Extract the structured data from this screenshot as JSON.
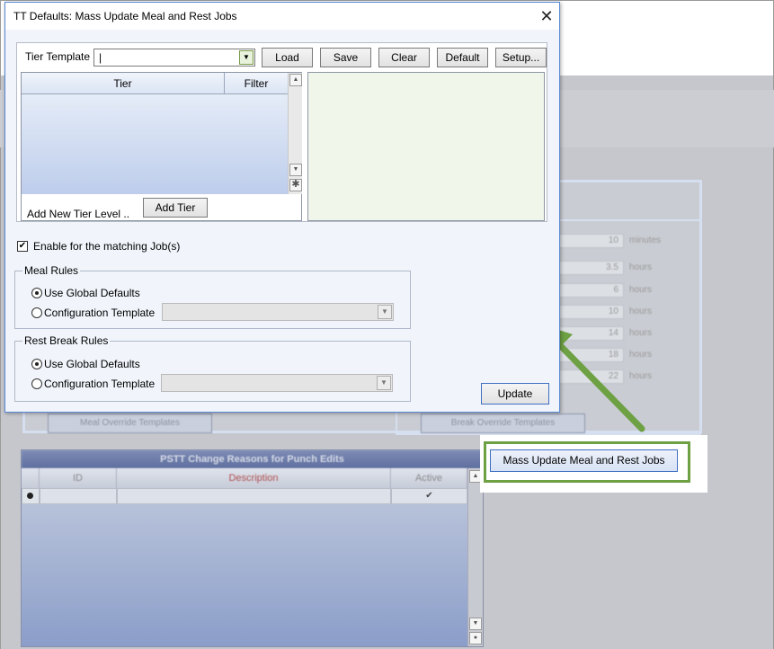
{
  "dialog": {
    "title": "TT Defaults: Mass Update Meal and Rest Jobs",
    "close_label": "✕",
    "tier_template_label": "Tier Template",
    "tier_template_value": "|",
    "buttons": {
      "load": "Load",
      "save": "Save",
      "clear": "Clear",
      "default": "Default",
      "setup": "Setup..."
    },
    "tier_grid": {
      "col_tier": "Tier",
      "col_filter": "Filter",
      "new_row_marker": "✱"
    },
    "add_new_tier_label": "Add New Tier Level ..",
    "add_tier_button": "Add Tier",
    "enable_label": "Enable for the matching Job(s)",
    "meal_rules": {
      "legend": "Meal Rules",
      "use_global": "Use Global Defaults",
      "config_template": "Configuration Template"
    },
    "rest_rules": {
      "legend": "Rest Break Rules",
      "use_global": "Use Global Defaults",
      "config_template": "Configuration Template"
    },
    "update_button": "Update"
  },
  "background": {
    "fields": [
      {
        "value": "10",
        "unit": "minutes"
      },
      {
        "value": "3.5",
        "unit": "hours"
      },
      {
        "value": "6",
        "unit": "hours"
      },
      {
        "value": "10",
        "unit": "hours"
      },
      {
        "value": "14",
        "unit": "hours"
      },
      {
        "value": "18",
        "unit": "hours"
      },
      {
        "value": "22",
        "unit": "hours"
      }
    ],
    "meal_override_button": "Meal Override Templates",
    "break_override_button": "Break Override Templates",
    "grid": {
      "title": "PSTT Change Reasons for Punch Edits",
      "col_id": "ID",
      "col_description": "Description",
      "col_active": "Active",
      "row_checkbox": "✔"
    }
  },
  "callout": {
    "button": "Mass Update Meal and Rest Jobs"
  },
  "colors": {
    "accent": "#6ea044",
    "dialog_border": "#5a8ad6"
  }
}
